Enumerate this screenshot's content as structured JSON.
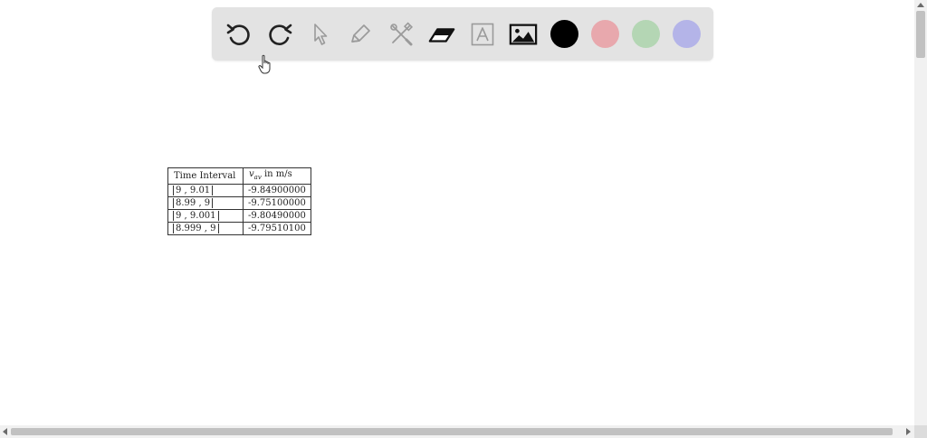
{
  "toolbar": {
    "tools": [
      {
        "icon": "undo-icon"
      },
      {
        "icon": "redo-icon"
      },
      {
        "icon": "select-pointer-icon"
      },
      {
        "icon": "pen-icon"
      },
      {
        "icon": "tools-icon"
      },
      {
        "icon": "eraser-icon"
      },
      {
        "icon": "text-box-icon"
      },
      {
        "icon": "image-icon"
      }
    ],
    "colors": [
      "#000000",
      "#e8a8ad",
      "#b4d6b4",
      "#b4b4e8"
    ]
  },
  "table": {
    "headers": [
      "Time Interval",
      "in m/s"
    ],
    "header_var": "v",
    "header_sub": "av",
    "rows": [
      {
        "interval": "9 , 9.01",
        "value": "-9.84900000"
      },
      {
        "interval": "8.99 , 9",
        "value": "-9.75100000"
      },
      {
        "interval": "9 , 9.001",
        "value": "-9.80490000"
      },
      {
        "interval": "8.999 , 9",
        "value": "-9.79510100"
      }
    ]
  }
}
